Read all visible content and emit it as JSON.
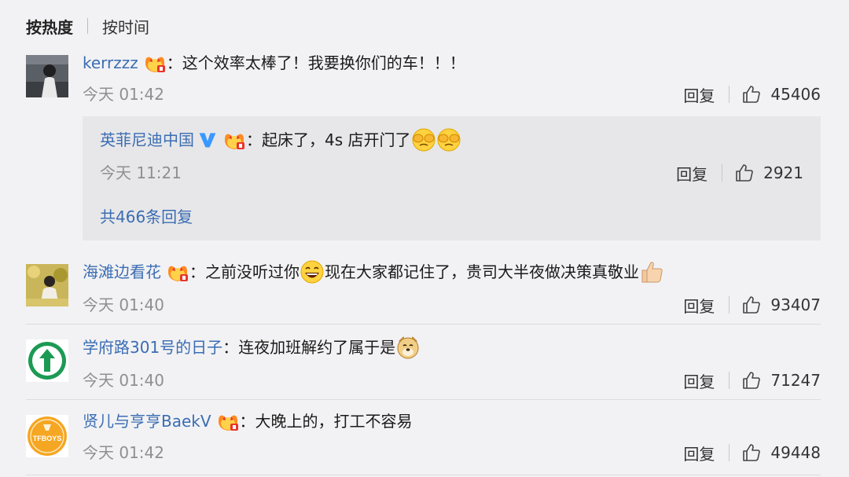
{
  "sort": {
    "hot": "按热度",
    "time": "按时间"
  },
  "comments": [
    {
      "user": "kerrzzz",
      "sep": "：",
      "text": "这个效率太棒了！我要换你们的车！！！",
      "time": "今天 01:42",
      "reply": "回复",
      "likes": "45406",
      "sub": {
        "user": "英菲尼迪中国",
        "sep": "：",
        "text": "起床了，4s 店开门了",
        "time": "今天 11:21",
        "reply": "回复",
        "likes": "2921",
        "more": "共466条回复"
      }
    },
    {
      "user": "海滩边看花",
      "sep": "：",
      "text_a": "之前没听过你",
      "text_b": "现在大家都记住了，贵司大半夜做决策真敬业",
      "time": "今天 01:40",
      "reply": "回复",
      "likes": "93407"
    },
    {
      "user": "学府路301号的日子",
      "sep": "：",
      "text": "连夜加班解约了属于是",
      "time": "今天 01:40",
      "reply": "回复",
      "likes": "71247"
    },
    {
      "user": "贤儿与亨亨BaekV",
      "sep": "：",
      "text": "大晚上的，打工不容易",
      "time": "今天 01:42",
      "reply": "回复",
      "likes": "49448",
      "avatar_text": "TFBOYS"
    }
  ],
  "colors": {
    "link": "#3b6db3",
    "meta": "#8f8f8f",
    "background": "#f2f2f4",
    "sub_background": "#e7e7e9"
  }
}
